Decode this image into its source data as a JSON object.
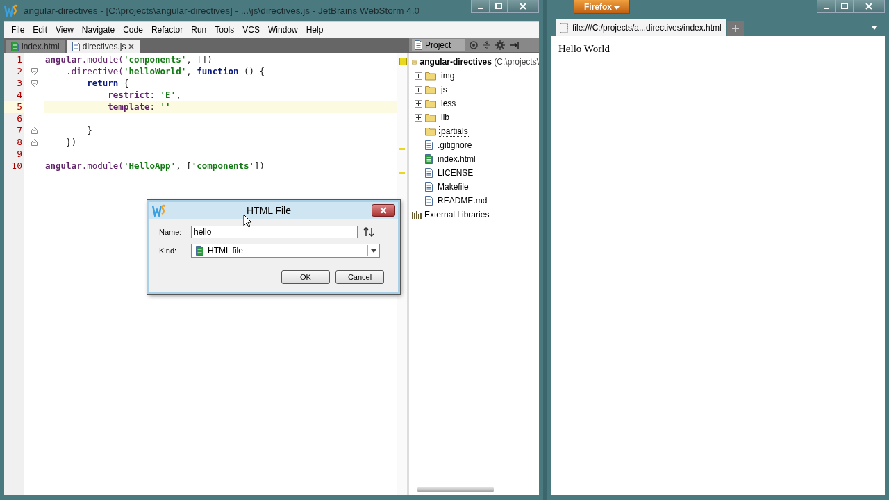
{
  "ide": {
    "title": "angular-directives - [C:\\projects\\angular-directives] - ...\\js\\directives.js - JetBrains WebStorm 4.0",
    "menu": [
      "File",
      "Edit",
      "View",
      "Navigate",
      "Code",
      "Refactor",
      "Run",
      "Tools",
      "VCS",
      "Window",
      "Help"
    ],
    "tabs": [
      {
        "label": "index.html",
        "kind": "html",
        "selected": false
      },
      {
        "label": "directives.js",
        "kind": "js",
        "selected": true
      }
    ],
    "editor": {
      "lines": [
        {
          "number": "1",
          "current": false,
          "tokens": [
            {
              "kind": "ident",
              "text": "angular"
            },
            {
              "kind": "method",
              "text": ".module("
            },
            {
              "kind": "string",
              "text": "'components'"
            },
            {
              "kind": "punct",
              "text": ", [])"
            }
          ]
        },
        {
          "number": "2",
          "current": false,
          "tokens": [
            {
              "kind": "method",
              "text": "    .directive("
            },
            {
              "kind": "string",
              "text": "'helloWorld'"
            },
            {
              "kind": "punct",
              "text": ", "
            },
            {
              "kind": "keyword",
              "text": "function"
            },
            {
              "kind": "punct",
              "text": " () {"
            }
          ]
        },
        {
          "number": "3",
          "current": false,
          "tokens": [
            {
              "kind": "keyword",
              "text": "        return"
            },
            {
              "kind": "punct",
              "text": " {"
            }
          ]
        },
        {
          "number": "4",
          "current": false,
          "tokens": [
            {
              "kind": "ident",
              "text": "            restrict"
            },
            {
              "kind": "punct",
              "text": ": "
            },
            {
              "kind": "string",
              "text": "'E'"
            },
            {
              "kind": "punct",
              "text": ","
            }
          ]
        },
        {
          "number": "5",
          "current": true,
          "tokens": [
            {
              "kind": "ident",
              "text": "            template"
            },
            {
              "kind": "punct",
              "text": ": "
            },
            {
              "kind": "string",
              "text": "''"
            }
          ]
        },
        {
          "number": "6",
          "current": false
        },
        {
          "number": "7",
          "current": false,
          "tokens": [
            {
              "kind": "punct",
              "text": "        }"
            }
          ]
        },
        {
          "number": "8",
          "current": false,
          "tokens": [
            {
              "kind": "punct",
              "text": "    })"
            }
          ]
        },
        {
          "number": "9",
          "current": false
        },
        {
          "number": "10",
          "current": false,
          "tokens": [
            {
              "kind": "ident",
              "text": "angular"
            },
            {
              "kind": "method",
              "text": ".module("
            },
            {
              "kind": "string",
              "text": "'HelloApp'"
            },
            {
              "kind": "punct",
              "text": ", ["
            },
            {
              "kind": "string",
              "text": "'components'"
            },
            {
              "kind": "punct",
              "text": "])"
            }
          ]
        }
      ]
    },
    "project": {
      "tab": "Project",
      "root": {
        "name": "angular-directives",
        "path": "(C:\\projects\\",
        "expanded": true,
        "children": [
          {
            "name": "img",
            "kind": "folder",
            "expanded": false,
            "selected": false
          },
          {
            "name": "js",
            "kind": "folder",
            "expanded": false,
            "selected": false
          },
          {
            "name": "less",
            "kind": "folder",
            "expanded": false,
            "selected": false
          },
          {
            "name": "lib",
            "kind": "folder",
            "expanded": false,
            "selected": false
          },
          {
            "name": "partials",
            "kind": "folder",
            "selected": true
          },
          {
            "name": ".gitignore",
            "kind": "text-file",
            "selected": false
          },
          {
            "name": "index.html",
            "kind": "html-file",
            "selected": false
          },
          {
            "name": "LICENSE",
            "kind": "text-file",
            "selected": false
          },
          {
            "name": "Makefile",
            "kind": "text-file",
            "selected": false
          },
          {
            "name": "README.md",
            "kind": "text-file",
            "selected": false
          }
        ]
      },
      "external": "External Libraries"
    },
    "dialog": {
      "title": "HTML File",
      "name_label": "Name:",
      "name_value": "hello",
      "kind_label": "Kind:",
      "kind_value": "HTML file",
      "buttons": [
        "OK",
        "Cancel"
      ]
    }
  },
  "firefox": {
    "menu_button": "Firefox",
    "tab": "file:///C:/projects/a...directives/index.html",
    "content": "Hello World"
  }
}
